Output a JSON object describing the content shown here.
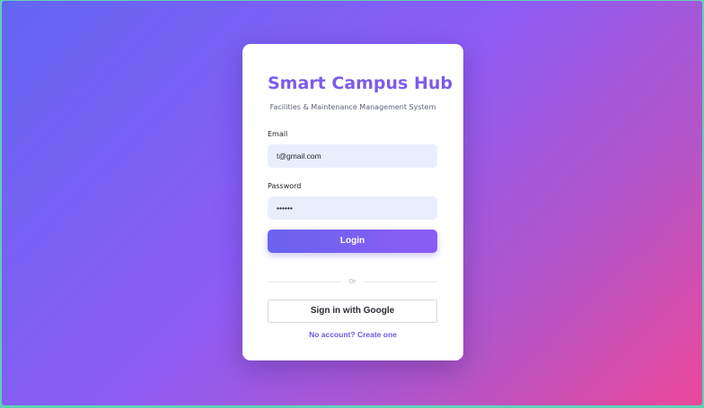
{
  "app": {
    "title": "Smart Campus Hub",
    "subtitle": "Facilities & Maintenance Management System"
  },
  "form": {
    "email_label": "Email",
    "email_value": "t@gmail.com",
    "password_label": "Password",
    "password_value": "••••••",
    "login_label": "Login",
    "divider_text": "Or",
    "google_label": "Sign in with Google",
    "register_label": "No account? Create one"
  },
  "colors": {
    "accent": "#7c5ce8",
    "background_start": "#6366f1",
    "background_end": "#ec4899",
    "input_bg": "#e8effb"
  }
}
